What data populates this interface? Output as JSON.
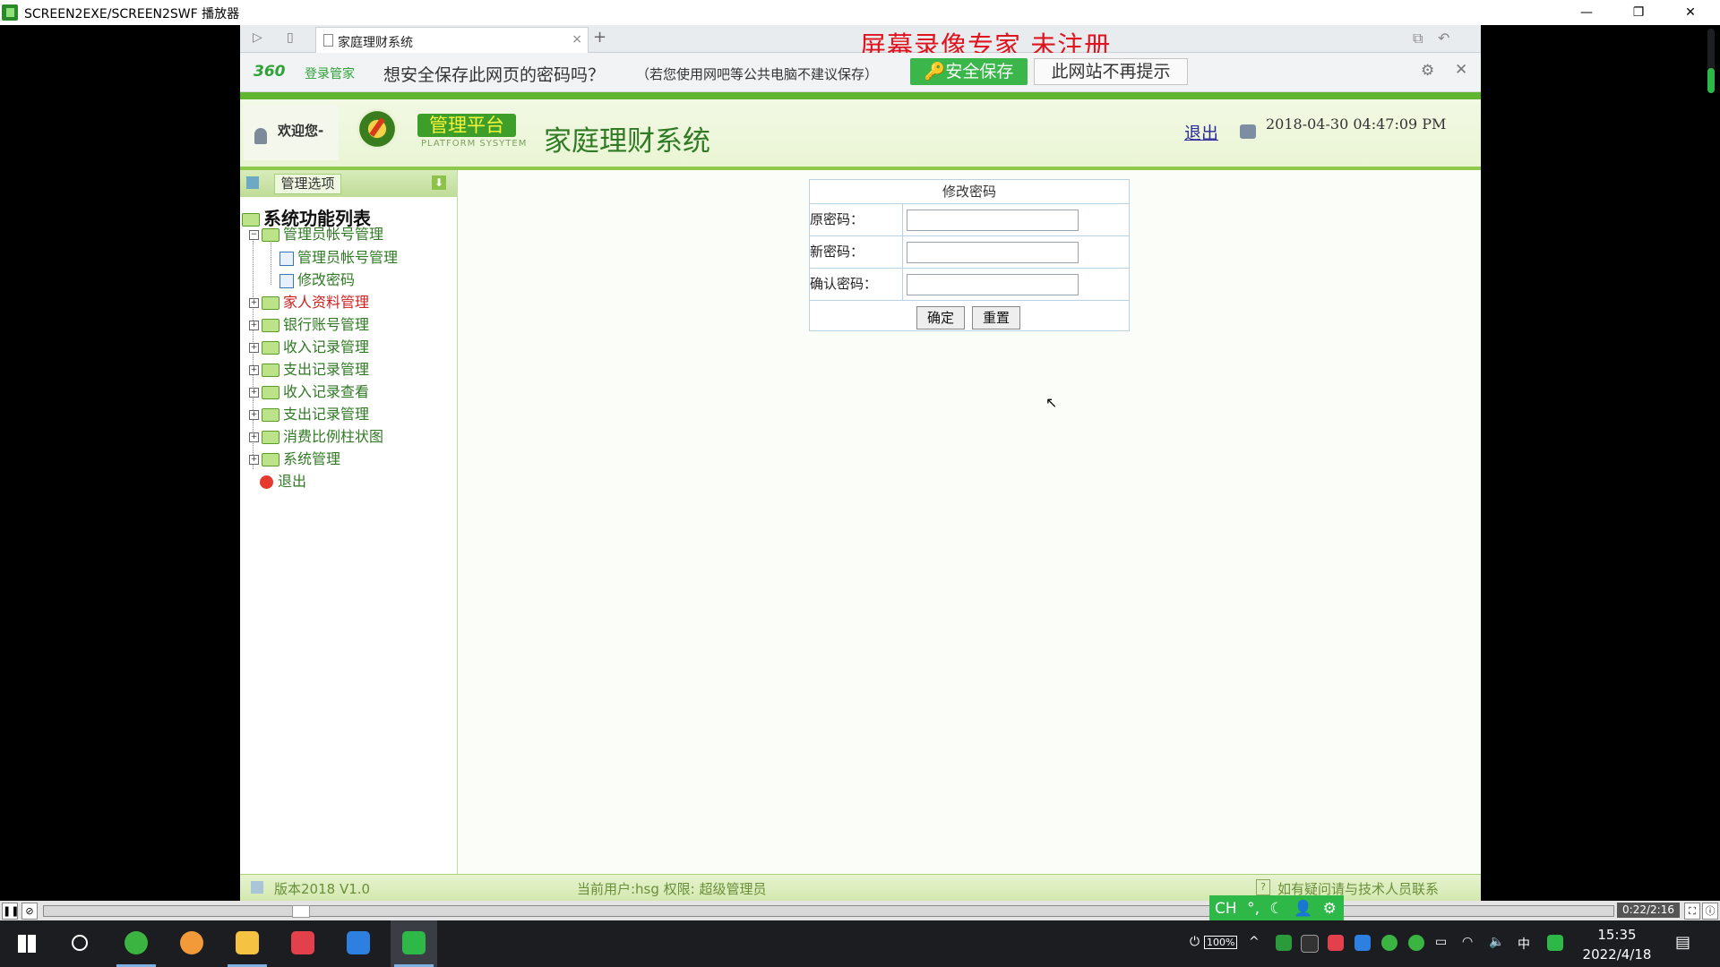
{
  "player": {
    "title": "SCREEN2EXE/SCREEN2SWF 播放器",
    "minimize": "—",
    "restore": "❐",
    "close": "✕",
    "elapsed": "0:22/2:16",
    "progress_fraction": 0.16
  },
  "browser": {
    "tab_title": "家庭理财系统",
    "tab_close": "×",
    "new_tab": "+",
    "watermark": "屏幕录像专家  未注册"
  },
  "password_bar": {
    "brand": "360",
    "brand_sub": "登录管家",
    "question": "想安全保存此网页的密码吗？",
    "hint": "（若您使用网吧等公共电脑不建议保存）",
    "save_button": "安全保存",
    "never_button": "此网站不再提示"
  },
  "header": {
    "welcome": "欢迎您-",
    "platform": "管理平台",
    "platform_sub": "PLATFORM SYSYTEM",
    "system_title": "家庭理财系统",
    "logout": "退出",
    "datetime": "2018-04-30 04:47:09 PM"
  },
  "sidebar": {
    "options_label": "管理选项",
    "root": "系统功能列表",
    "groups": [
      {
        "label": "管理员帐号管理",
        "expanded": true,
        "children": [
          "管理员帐号管理",
          "修改密码"
        ]
      },
      {
        "label": "家人资料管理",
        "highlight": true
      },
      {
        "label": "银行账号管理"
      },
      {
        "label": "收入记录管理"
      },
      {
        "label": "支出记录管理"
      },
      {
        "label": "收入记录查看"
      },
      {
        "label": "支出记录管理"
      },
      {
        "label": "消费比例柱状图"
      },
      {
        "label": "系统管理"
      }
    ],
    "exit": "退出"
  },
  "form": {
    "title": "修改密码",
    "old_label": "原密码：",
    "new_label": "新密码：",
    "confirm_label": "确认密码：",
    "old_value": "",
    "new_value": "",
    "confirm_value": "",
    "ok_button": "确定",
    "reset_button": "重置"
  },
  "footer": {
    "version": "版本2018 V1.0",
    "current_user": "当前用户:hsg 权限: 超级管理员",
    "contact": "如有疑问请与技术人员联系"
  },
  "ime": {
    "lang": "CH",
    "punct": "°,",
    "moon": "☾",
    "user": "👤",
    "gear": "⚙"
  },
  "taskbar": {
    "battery": "100%",
    "ime_lang": "中",
    "time": "15:35",
    "date": "2022/4/18"
  },
  "colors": {
    "header_green": "#5fb52f",
    "watermark_red": "#e0141e",
    "save_green": "#3ab64a"
  }
}
